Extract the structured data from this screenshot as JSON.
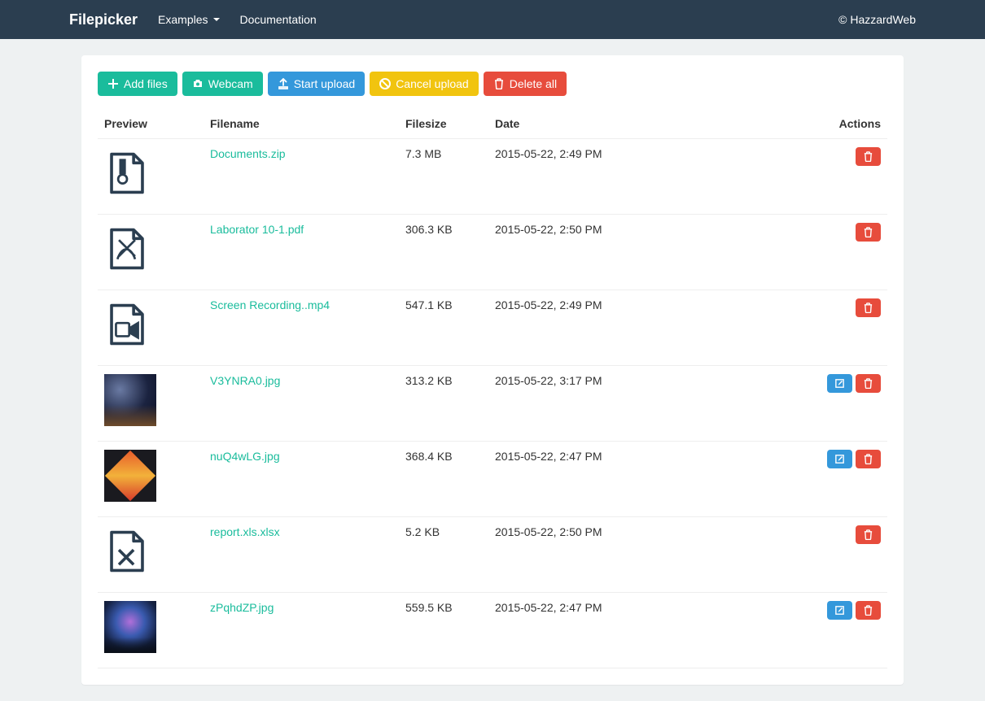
{
  "nav": {
    "brand": "Filepicker",
    "examples": "Examples",
    "documentation": "Documentation",
    "copyright": "© HazzardWeb"
  },
  "toolbar": {
    "add_files": "Add files",
    "webcam": "Webcam",
    "start_upload": "Start upload",
    "cancel_upload": "Cancel upload",
    "delete_all": "Delete all"
  },
  "columns": {
    "preview": "Preview",
    "filename": "Filename",
    "filesize": "Filesize",
    "date": "Date",
    "actions": "Actions"
  },
  "files": [
    {
      "preview_type": "zip",
      "name": "Documents.zip",
      "size": "7.3 MB",
      "date": "2015-05-22, 2:49 PM",
      "editable": false
    },
    {
      "preview_type": "pdf",
      "name": "Laborator 10-1.pdf",
      "size": "306.3 KB",
      "date": "2015-05-22, 2:50 PM",
      "editable": false
    },
    {
      "preview_type": "video",
      "name": "Screen Recording..mp4",
      "size": "547.1 KB",
      "date": "2015-05-22, 2:49 PM",
      "editable": false
    },
    {
      "preview_type": "thumb1",
      "name": "V3YNRA0.jpg",
      "size": "313.2 KB",
      "date": "2015-05-22, 3:17 PM",
      "editable": true
    },
    {
      "preview_type": "thumb2",
      "name": "nuQ4wLG.jpg",
      "size": "368.4 KB",
      "date": "2015-05-22, 2:47 PM",
      "editable": true
    },
    {
      "preview_type": "xls",
      "name": "report.xls.xlsx",
      "size": "5.2 KB",
      "date": "2015-05-22, 2:50 PM",
      "editable": false
    },
    {
      "preview_type": "thumb3",
      "name": "zPqhdZP.jpg",
      "size": "559.5 KB",
      "date": "2015-05-22, 2:47 PM",
      "editable": true
    }
  ]
}
